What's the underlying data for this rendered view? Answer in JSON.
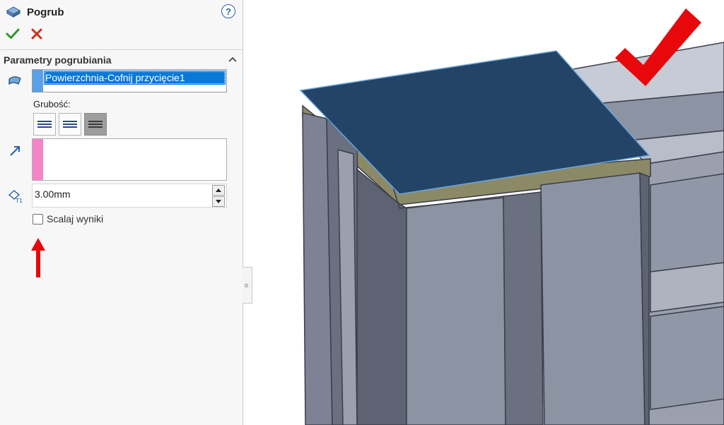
{
  "property_manager": {
    "title": "Pogrub",
    "title_icon": "thicken-icon",
    "help_label": "?",
    "ok_icon": "checkmark-icon",
    "cancel_icon": "close-icon",
    "group": {
      "title": "Parametry pogrubiania",
      "surface_selection": "Powierzchnia-Cofnij przycięcie1",
      "thickness_label": "Grubość:",
      "thickness_value": "3.00mm",
      "thickness_direction_selected": 3,
      "merge_result_label": "Scalaj wyniki",
      "merge_result_checked": false
    }
  },
  "colors": {
    "surface_selection_strip": "#58a0e8",
    "vector_selection_strip": "#f485c6",
    "annotation_red": "#e8070b",
    "selected_item": "#0a78d7",
    "model_face": "#8a8f9c",
    "surface_blue": "#234466"
  }
}
